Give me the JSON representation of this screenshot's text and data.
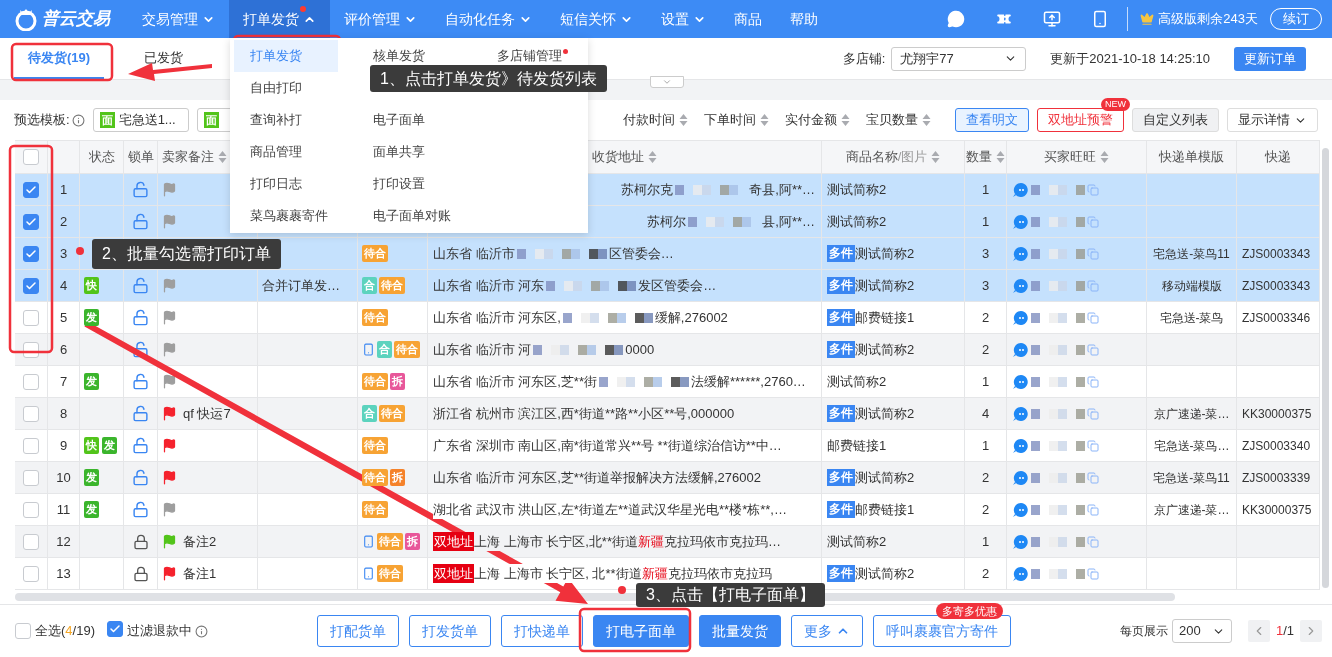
{
  "nav": {
    "logo": "普云交易",
    "items": [
      {
        "label": "交易管理",
        "selected": false,
        "has_menu": true,
        "dot": false
      },
      {
        "label": "打单发货",
        "selected": true,
        "has_menu": true,
        "dot": true
      },
      {
        "label": "评价管理",
        "selected": false,
        "has_menu": true,
        "dot": false
      },
      {
        "label": "自动化任务",
        "selected": false,
        "has_menu": true,
        "dot": false
      },
      {
        "label": "短信关怀",
        "selected": false,
        "has_menu": true,
        "dot": false
      },
      {
        "label": "设置",
        "selected": false,
        "has_menu": true,
        "dot": false
      },
      {
        "label": "商品",
        "selected": false,
        "has_menu": false,
        "dot": false
      },
      {
        "label": "帮助",
        "selected": false,
        "has_menu": false,
        "dot": false
      }
    ],
    "plan": "高级版剩余243天",
    "renew": "续订"
  },
  "dropdown": {
    "columns": [
      [
        {
          "label": "打单发货",
          "selected": true,
          "dot": false
        },
        {
          "label": "自由打印",
          "selected": false,
          "dot": false
        },
        {
          "label": "查询补打",
          "selected": false,
          "dot": false
        },
        {
          "label": "商品管理",
          "selected": false,
          "dot": false
        },
        {
          "label": "打印日志",
          "selected": false,
          "dot": false
        },
        {
          "label": "菜鸟裹裹寄件",
          "selected": false,
          "dot": false
        }
      ],
      [
        {
          "label": "核单发货",
          "selected": false,
          "dot": false
        },
        {
          "label": "电子面单",
          "selected": false,
          "dot": false
        },
        {
          "label": "面单共享",
          "selected": false,
          "dot": false
        },
        {
          "label": "打印设置",
          "selected": false,
          "dot": false
        },
        {
          "label": "电子面单对账",
          "selected": false,
          "dot": false
        }
      ],
      [
        {
          "label": "多店铺管理",
          "selected": false,
          "dot": true
        }
      ]
    ]
  },
  "tabs": [
    {
      "label": "待发货(19)",
      "selected": true
    },
    {
      "label": "已发货",
      "selected": false
    }
  ],
  "shop": {
    "label": "多店铺:",
    "value": "尤翔宇77"
  },
  "updated": "更新于2021-10-18 14:25:10",
  "refresh": "更新订单",
  "toolbar": {
    "template_label": "预选模板:",
    "templates": [
      {
        "badge": "面",
        "label": "宅急送1..."
      },
      {
        "badge": "面"
      }
    ],
    "sorts": [
      "付款时间",
      "下单时间",
      "实付金额",
      "宝贝数量"
    ],
    "buttons": [
      {
        "label": "查看明文",
        "kind": "light"
      },
      {
        "label": "双地址预警",
        "kind": "danger",
        "badge": "NEW"
      },
      {
        "label": "自定义列表",
        "kind": "gray"
      },
      {
        "label": "显示详情",
        "kind": "dropdown"
      }
    ]
  },
  "table": {
    "all_checked": false,
    "columns": [
      {},
      {},
      {
        "label": "状态",
        "sortable": false
      },
      {
        "label": "锁单",
        "sortable": false
      },
      {
        "label": "卖家备注",
        "sortable": true
      },
      {},
      {},
      {
        "label": "收货地址",
        "sortable": true
      },
      {
        "label": "商品名称",
        "sub": "/图片",
        "sortable": true
      },
      {
        "label": "数量",
        "sortable": true
      },
      {
        "label": "买家旺旺",
        "sortable": true
      },
      {
        "label": "快递单模版",
        "sortable": false
      },
      {
        "label": "快递",
        "sortable": false
      }
    ],
    "rows": [
      {
        "no": "1",
        "checked": true,
        "status": [],
        "locked": false,
        "flag": {
          "color": "#9e9e9e"
        },
        "phone": false,
        "tags": [],
        "partly_hidden": true,
        "address": [
          {
            "kind": "plain",
            "text": "苏柯尔克"
          },
          {
            "kind": "mask"
          },
          {
            "kind": "plain",
            "text": "奇县,阿**…"
          }
        ],
        "product": "测试简称2",
        "qty": "1"
      },
      {
        "no": "2",
        "checked": true,
        "status": [],
        "locked": false,
        "flag": {
          "color": "#9e9e9e"
        },
        "phone": false,
        "tags": [],
        "partly_hidden": true,
        "address": [
          {
            "kind": "plain",
            "text": "苏柯尔"
          },
          {
            "kind": "mask"
          },
          {
            "kind": "plain",
            "text": "县,阿**…"
          }
        ],
        "product": "测试简称2",
        "qty": "1"
      },
      {
        "no": "3",
        "checked": true,
        "status": [],
        "phone": false,
        "tags": [
          {
            "text": "待合",
            "color": "#f7a334"
          }
        ],
        "partly_hidden": false,
        "address": [
          {
            "kind": "plain",
            "text": "山东省 临沂市"
          },
          {
            "kind": "mask"
          },
          {
            "kind": "plain",
            "text": "区管委会…"
          }
        ],
        "multi_tag": "多件",
        "product": "测试简称2",
        "qty": "3",
        "template": "宅急送-菜鸟11",
        "express": "ZJS0003343"
      },
      {
        "no": "4",
        "checked": true,
        "status": [
          {
            "text": "快",
            "color": "#52c41a"
          }
        ],
        "locked": false,
        "flag": {
          "color": "#9e9e9e"
        },
        "note": "合并订单发…",
        "phone": false,
        "tags": [
          {
            "text": "合",
            "color": "#5cd3be"
          },
          {
            "text": "待合",
            "color": "#f7a334"
          }
        ],
        "partly_hidden": false,
        "address": [
          {
            "kind": "plain",
            "text": "山东省 临沂市 河东"
          },
          {
            "kind": "mask"
          },
          {
            "kind": "plain",
            "text": "发区管委会…"
          }
        ],
        "multi_tag": "多件",
        "product": "测试简称2",
        "qty": "3",
        "template": "移动端模版",
        "express": "ZJS0003343"
      },
      {
        "no": "5",
        "checked": false,
        "status": [
          {
            "text": "发",
            "color": "#3bb52c"
          }
        ],
        "locked": false,
        "flag": {
          "color": "#9e9e9e"
        },
        "phone": false,
        "tags": [
          {
            "text": "待合",
            "color": "#f7a334"
          }
        ],
        "partly_hidden": false,
        "address": [
          {
            "kind": "plain",
            "text": "山东省 临沂市 河东区,"
          },
          {
            "kind": "mask"
          },
          {
            "kind": "plain",
            "text": "缓解,276002"
          }
        ],
        "multi_tag": "多件",
        "product": "邮费链接1",
        "qty": "2",
        "template": "宅急送-菜鸟",
        "express": "ZJS0003346"
      },
      {
        "no": "6",
        "checked": false,
        "status": [],
        "locked": false,
        "flag": {
          "color": "#9e9e9e"
        },
        "phone": true,
        "tags": [
          {
            "text": "合",
            "color": "#5cd3be"
          },
          {
            "text": "待合",
            "color": "#f7a334"
          }
        ],
        "partly_hidden": false,
        "address": [
          {
            "kind": "plain",
            "text": "山东省 临沂市 河"
          },
          {
            "kind": "mask"
          },
          {
            "kind": "plain",
            "text": "0000"
          }
        ],
        "multi_tag": "多件",
        "product": "测试简称2",
        "qty": "2"
      },
      {
        "no": "7",
        "checked": false,
        "status": [
          {
            "text": "发",
            "color": "#3bb52c"
          }
        ],
        "locked": false,
        "flag": {
          "color": "#9e9e9e"
        },
        "phone": false,
        "tags": [
          {
            "text": "待合",
            "color": "#f7a334"
          },
          {
            "text": "拆",
            "color": "#e8579a"
          }
        ],
        "partly_hidden": false,
        "address": [
          {
            "kind": "plain",
            "text": "山东省 临沂市 河东区,芝**街"
          },
          {
            "kind": "mask"
          },
          {
            "kind": "plain",
            "text": "法缓解******,2760…"
          }
        ],
        "product": "测试简称2",
        "qty": "1"
      },
      {
        "no": "8",
        "checked": false,
        "status": [],
        "locked": false,
        "flag": {
          "color": "#f5222d"
        },
        "remark": "qf 快运7",
        "phone": false,
        "tags": [
          {
            "text": "合",
            "color": "#5cd3be"
          },
          {
            "text": "待合",
            "color": "#f7a334"
          }
        ],
        "partly_hidden": false,
        "address": [
          {
            "kind": "plain",
            "text": "浙江省 杭州市 滨江区,西*街道**路**小区**号,000000"
          }
        ],
        "multi_tag": "多件",
        "product": "测试简称2",
        "qty": "4",
        "template": "京广速递-菜…",
        "express": "KK30000375"
      },
      {
        "no": "9",
        "checked": false,
        "status": [
          {
            "text": "快",
            "color": "#52c41a"
          },
          {
            "text": "发",
            "color": "#3bb52c"
          }
        ],
        "locked": false,
        "flag": {
          "color": "#f5222d"
        },
        "phone": false,
        "tags": [
          {
            "text": "待合",
            "color": "#f7a334"
          }
        ],
        "partly_hidden": false,
        "address": [
          {
            "kind": "plain",
            "text": "广东省 深圳市 南山区,南*街道常兴**号 **街道综治信访**中…"
          }
        ],
        "product": "邮费链接1",
        "qty": "1",
        "template": "宅急送-菜鸟…",
        "express": "ZJS0003340"
      },
      {
        "no": "10",
        "checked": false,
        "status": [
          {
            "text": "发",
            "color": "#3bb52c"
          }
        ],
        "locked": false,
        "flag": {
          "color": "#f5222d"
        },
        "phone": false,
        "tags": [
          {
            "text": "待合",
            "color": "#f7a334"
          },
          {
            "text": "拆",
            "color": "#f5822a"
          }
        ],
        "partly_hidden": false,
        "address": [
          {
            "kind": "plain",
            "text": "山东省 临沂市 河东区,芝**街道举报解决方法缓解,276002"
          }
        ],
        "multi_tag": "多件",
        "product": "测试简称2",
        "qty": "2",
        "template": "宅急送-菜鸟11",
        "express": "ZJS0003339"
      },
      {
        "no": "11",
        "checked": false,
        "status": [
          {
            "text": "发",
            "color": "#3bb52c"
          }
        ],
        "locked": false,
        "flag": {
          "color": "#9e9e9e"
        },
        "phone": false,
        "tags": [
          {
            "text": "待合",
            "color": "#f7a334"
          }
        ],
        "partly_hidden": false,
        "address": [
          {
            "kind": "plain",
            "text": "湖北省 武汉市 洪山区,左*街道左**道武汉华星光电**楼*栋**,…"
          }
        ],
        "multi_tag": "多件",
        "product": "邮费链接1",
        "qty": "2",
        "template": "京广速递-菜…",
        "express": "KK30000375"
      },
      {
        "no": "12",
        "checked": false,
        "status": [],
        "locked": true,
        "flag": {
          "color": "#52c41a"
        },
        "remark": "备注2",
        "phone": true,
        "tags": [
          {
            "text": "待合",
            "color": "#f7a334"
          },
          {
            "text": "拆",
            "color": "#e8579a"
          }
        ],
        "partly_hidden": false,
        "address": [
          {
            "kind": "tag",
            "text": "双地址"
          },
          {
            "kind": "plain",
            "text": "上海 上海市 长宁区,北**街道"
          },
          {
            "kind": "red",
            "text": "新疆"
          },
          {
            "kind": "plain",
            "text": "克拉玛依市克拉玛…"
          }
        ],
        "product": "测试简称2",
        "qty": "1"
      },
      {
        "no": "13",
        "checked": false,
        "status": [],
        "locked": true,
        "flag": {
          "color": "#f5222d"
        },
        "remark": "备注1",
        "phone": true,
        "tags": [
          {
            "text": "待合",
            "color": "#f7a334"
          }
        ],
        "partly_hidden": false,
        "address": [
          {
            "kind": "tag",
            "text": "双地址"
          },
          {
            "kind": "plain",
            "text": "上海 上海市 长宁区, 北**街道 "
          },
          {
            "kind": "red",
            "text": "新疆"
          },
          {
            "kind": "plain",
            "text": "克拉玛依市克拉玛"
          }
        ],
        "multi_tag": "多件",
        "product": "测试简称2",
        "qty": "2"
      }
    ]
  },
  "footer": {
    "select_all": {
      "label": "全选(",
      "count": "4",
      "total": "/19)",
      "checked": false
    },
    "filter": {
      "label": "过滤退款中",
      "checked": true
    },
    "actions": [
      {
        "label": "打配货单",
        "kind": "outline"
      },
      {
        "label": "打发货单",
        "kind": "outline"
      },
      {
        "label": "打快递单",
        "kind": "outline"
      },
      {
        "label": "打电子面单",
        "kind": "primary"
      },
      {
        "label": "批量发货",
        "kind": "primary"
      },
      {
        "label": "更多",
        "kind": "more"
      },
      {
        "label": "呼叫裹裹官方寄件",
        "kind": "outline",
        "badge": "多寄多优惠"
      }
    ],
    "per_page_label": "每页展示",
    "per_page": "200",
    "page": "1",
    "pages": "/1"
  },
  "callouts": [
    "1、点击打单发货》待发货列表",
    "2、批量勾选需打印订单",
    "3、点击【打电子面单】"
  ]
}
